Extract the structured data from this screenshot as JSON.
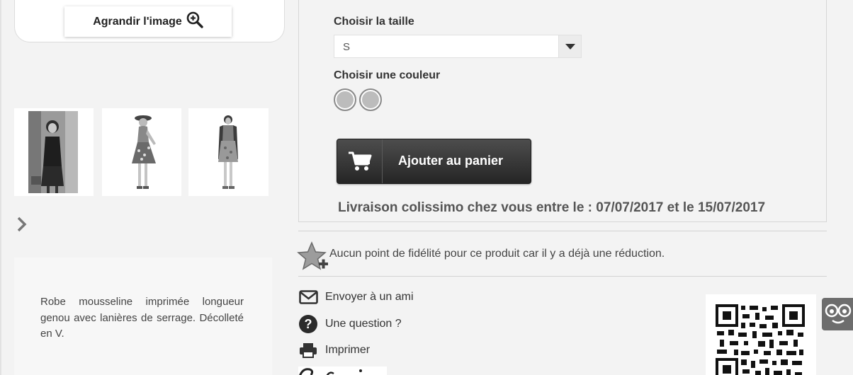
{
  "gallery": {
    "zoom_label": "Agrandir l'image",
    "thumbnails": [
      {
        "alt": "Robe photo 1"
      },
      {
        "alt": "Robe photo 2"
      },
      {
        "alt": "Robe photo 3"
      }
    ]
  },
  "description": "Robe mousseline imprimée longueur genou avec lanières de serrage. Décolleté en V.",
  "options": {
    "size_label": "Choisir la taille",
    "size_value": "S",
    "color_label": "Choisir une couleur",
    "colors": [
      "#bcbcbc",
      "#bcbcbc"
    ]
  },
  "cart": {
    "button_label": "Ajouter au panier"
  },
  "delivery_text": "Livraison colissimo chez vous entre le : 07/07/2017 et le 15/07/2017",
  "loyalty_text": "Aucun point de fidélité pour ce produit car il y a déjà une réduction.",
  "actions": [
    {
      "label": "Envoyer à un ami",
      "icon": "envelope-icon"
    },
    {
      "label": "Une question ?",
      "icon": "question-icon"
    },
    {
      "label": "Imprimer",
      "icon": "printer-icon"
    }
  ],
  "accessibility_icon": "eyes-face-icon"
}
